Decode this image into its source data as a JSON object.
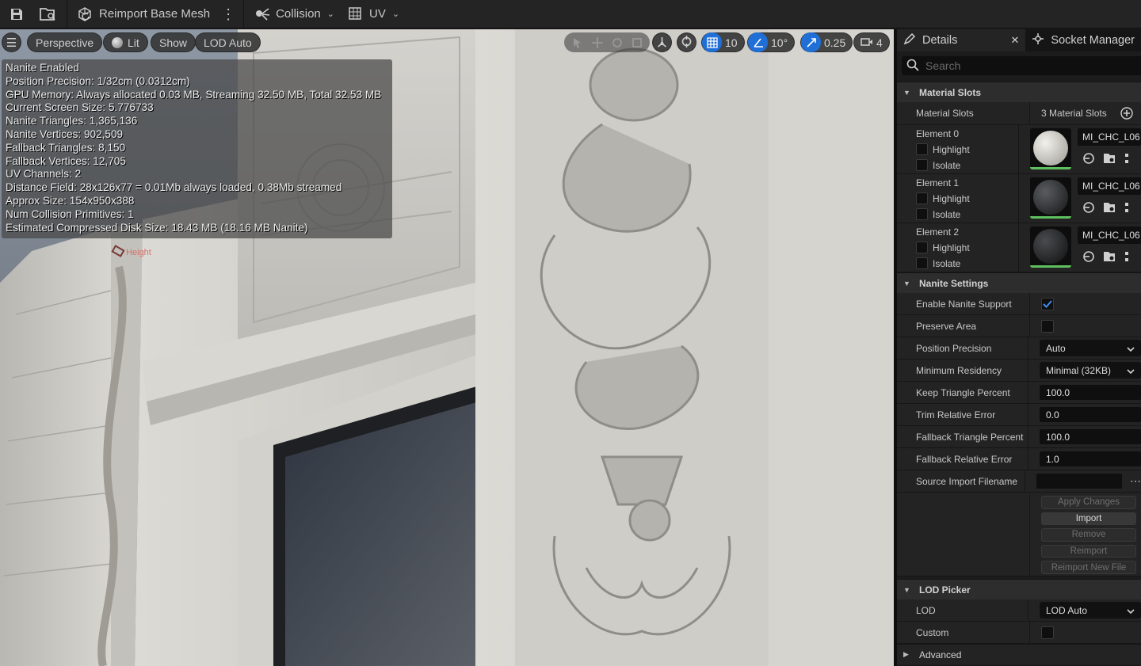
{
  "toolbar": {
    "reimport_label": "Reimport Base Mesh",
    "collision_label": "Collision",
    "uv_label": "UV"
  },
  "viewport": {
    "view_mode": "Perspective",
    "lighting": "Lit",
    "show": "Show",
    "lod": "LOD Auto",
    "grid_snap": "10",
    "rotation_snap": "10°",
    "scale_snap": "0.25",
    "camera_speed": "4",
    "stats": [
      "Nanite Enabled",
      "Position Precision: 1/32cm (0.0312cm)",
      "GPU Memory: Always allocated 0.03 MB, Streaming 32.50 MB, Total 32.53 MB",
      "Current Screen Size: 5.776733",
      "Nanite Triangles: 1,365,136",
      "Nanite Vertices: 902,509",
      "Fallback Triangles: 8,150",
      "Fallback Vertices: 12,705",
      "UV Channels: 2",
      "Distance Field: 28x126x77 = 0.01Mb always loaded, 0.38Mb streamed",
      "Approx Size: 154x950x388",
      "Num Collision Primitives: 1",
      "Estimated Compressed Disk Size: 18.43 MB (18.16 MB Nanite)"
    ],
    "camera_tag": "Height"
  },
  "details": {
    "tab_details": "Details",
    "tab_socket_manager": "Socket Manager",
    "search_placeholder": "Search",
    "material_slots": {
      "header": "Material Slots",
      "label": "Material Slots",
      "count": "3 Material Slots",
      "elements": [
        {
          "name": "Element 0",
          "highlight": "Highlight",
          "isolate": "Isolate",
          "material": "MI_CHC_L06"
        },
        {
          "name": "Element 1",
          "highlight": "Highlight",
          "isolate": "Isolate",
          "material": "MI_CHC_L06"
        },
        {
          "name": "Element 2",
          "highlight": "Highlight",
          "isolate": "Isolate",
          "material": "MI_CHC_L06"
        }
      ]
    },
    "nanite": {
      "header": "Nanite Settings",
      "enable_support_label": "Enable Nanite Support",
      "enable_support": true,
      "preserve_area_label": "Preserve Area",
      "preserve_area": false,
      "position_precision_label": "Position Precision",
      "position_precision": "Auto",
      "minimum_residency_label": "Minimum Residency",
      "minimum_residency": "Minimal (32KB)",
      "keep_triangle_percent_label": "Keep Triangle Percent",
      "keep_triangle_percent": "100.0",
      "trim_relative_error_label": "Trim Relative Error",
      "trim_relative_error": "0.0",
      "fallback_triangle_percent_label": "Fallback Triangle Percent",
      "fallback_triangle_percent": "100.0",
      "fallback_relative_error_label": "Fallback Relative Error",
      "fallback_relative_error": "1.0",
      "source_import_filename_label": "Source Import Filename",
      "source_import_filename": "",
      "buttons": {
        "apply_changes": "Apply Changes",
        "import": "Import",
        "remove": "Remove",
        "reimport": "Reimport",
        "reimport_new_file": "Reimport New File"
      }
    },
    "lod_picker": {
      "header": "LOD Picker",
      "lod_label": "LOD",
      "lod_value": "LOD Auto",
      "custom_label": "Custom",
      "custom": false
    },
    "advanced": {
      "header": "Advanced"
    }
  },
  "colors": {
    "accent_blue": "#1f6fd6",
    "material_ok": "#5ec05e"
  }
}
